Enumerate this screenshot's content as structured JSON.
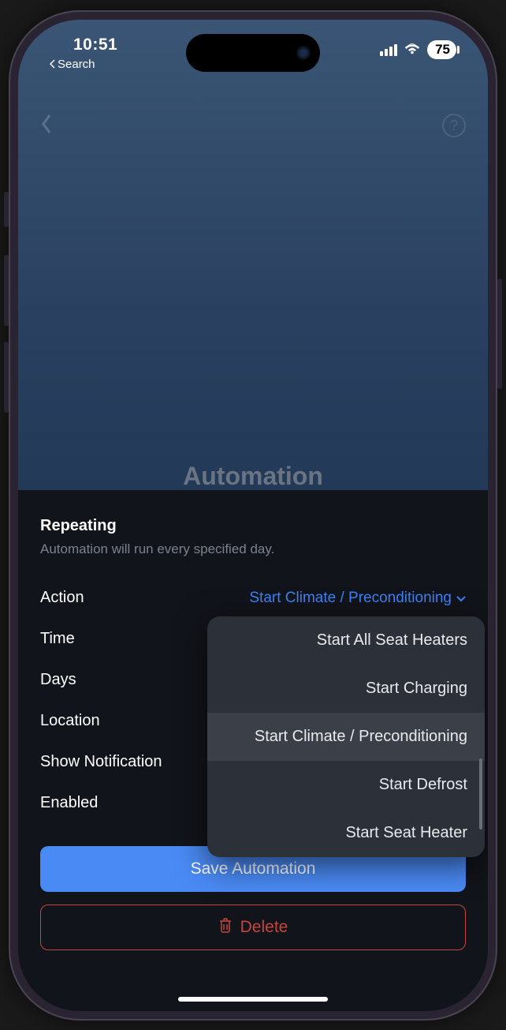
{
  "status": {
    "time": "10:51",
    "back_label": "Search",
    "battery": "75"
  },
  "nav": {
    "help_glyph": "?"
  },
  "page": {
    "title": "Automation"
  },
  "section": {
    "title": "Repeating",
    "subtitle": "Automation will run every specified day."
  },
  "rows": {
    "action": {
      "label": "Action",
      "value": "Start Climate / Preconditioning"
    },
    "time": {
      "label": "Time"
    },
    "days": {
      "label": "Days"
    },
    "location": {
      "label": "Location"
    },
    "notification": {
      "label": "Show Notification"
    },
    "enabled": {
      "label": "Enabled"
    }
  },
  "dropdown": {
    "options": [
      "Start All Seat Heaters",
      "Start Charging",
      "Start Climate / Preconditioning",
      "Start Defrost",
      "Start Seat Heater"
    ],
    "selected_index": 2
  },
  "buttons": {
    "save": "Save Automation",
    "delete": "Delete"
  }
}
